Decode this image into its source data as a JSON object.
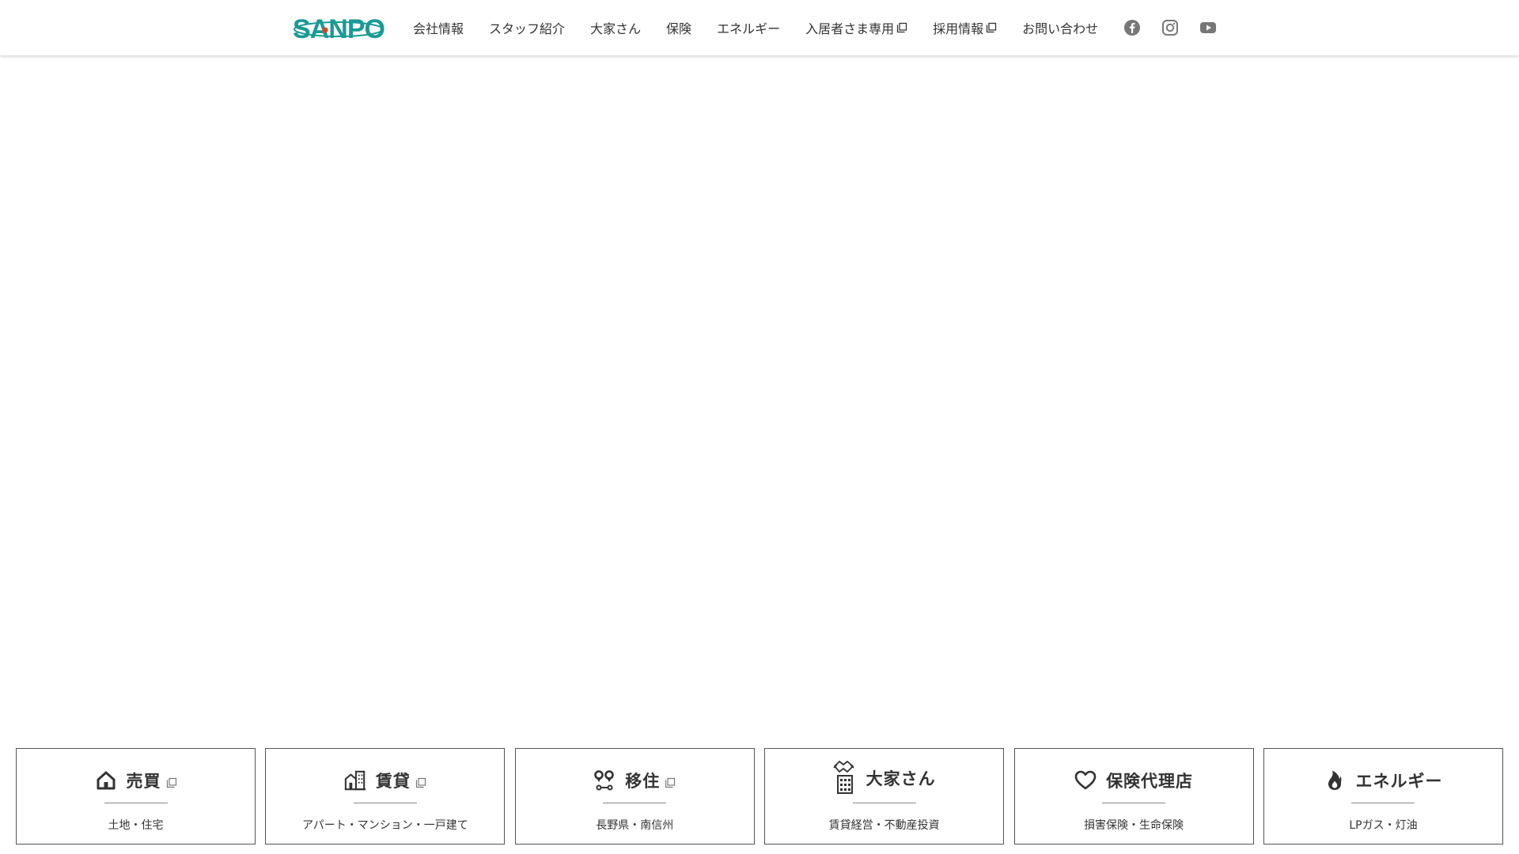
{
  "header": {
    "logo_text": "SANPO",
    "nav": [
      {
        "label": "会社情報",
        "external": false
      },
      {
        "label": "スタッフ紹介",
        "external": false
      },
      {
        "label": "大家さん",
        "external": false
      },
      {
        "label": "保険",
        "external": false
      },
      {
        "label": "エネルギー",
        "external": false
      },
      {
        "label": "入居者さま専用",
        "external": true
      },
      {
        "label": "採用情報",
        "external": true
      },
      {
        "label": "お問い合わせ",
        "external": false
      }
    ],
    "social": [
      "facebook-icon",
      "instagram-icon",
      "youtube-icon"
    ]
  },
  "cards": [
    {
      "title": "売買",
      "subtitle": "土地・住宅",
      "icon": "house-icon",
      "external": true
    },
    {
      "title": "賃貸",
      "subtitle": "アパート・マンション・一戸建て",
      "icon": "apartment-building-icon",
      "external": true
    },
    {
      "title": "移住",
      "subtitle": "長野県・南信州",
      "icon": "location-pins-icon",
      "external": true
    },
    {
      "title": "大家さん",
      "subtitle": "賃貸経営・不動産投資",
      "icon": "handshake-building-icon",
      "external": false
    },
    {
      "title": "保険代理店",
      "subtitle": "損害保険・生命保険",
      "icon": "heart-icon",
      "external": false
    },
    {
      "title": "エネルギー",
      "subtitle": "LPガス・灯油",
      "icon": "flame-icon",
      "external": false
    }
  ],
  "colors": {
    "brand_teal": "#1a9a96",
    "brand_dot": "#e04020",
    "social_gray": "#777777",
    "border": "#555555"
  }
}
